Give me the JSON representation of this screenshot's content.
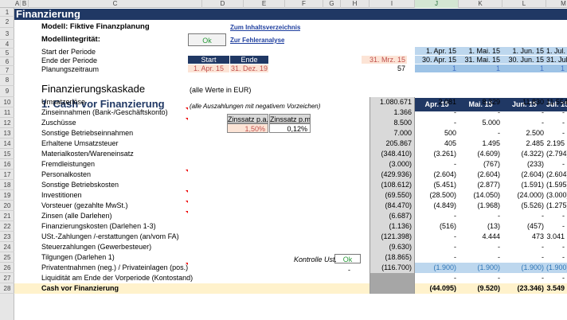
{
  "columns": [
    {
      "id": "A",
      "w": 8
    },
    {
      "id": "B",
      "w": 10
    },
    {
      "id": "C",
      "w": 218
    },
    {
      "id": "D",
      "w": 52
    },
    {
      "id": "E",
      "w": 52
    },
    {
      "id": "F",
      "w": 48
    },
    {
      "id": "G",
      "w": 22
    },
    {
      "id": "H",
      "w": 36
    },
    {
      "id": "I",
      "w": 57
    },
    {
      "id": "J",
      "w": 55
    },
    {
      "id": "K",
      "w": 55
    },
    {
      "id": "L",
      "w": 55
    },
    {
      "id": "M",
      "w": 44
    }
  ],
  "row_numbers": [
    "1",
    "2",
    "3",
    "4",
    "5",
    "6",
    "7",
    "8",
    "9",
    "10",
    "11",
    "12",
    "13",
    "14",
    "15",
    "16",
    "17",
    "18",
    "19",
    "20",
    "21",
    "22",
    "23",
    "24",
    "25",
    "26",
    "27",
    "28"
  ],
  "header": {
    "title": "Finanzierung",
    "model_label": "Modell: Fiktive Finanzplanung",
    "integrity_label": "Modellintegrität:",
    "integrity_value": "Ok",
    "link_contents": "Zum Inhaltsverzeichnis",
    "link_errors": "Zur Fehleranalyse",
    "start_label": "Start der Periode",
    "end_label": "Ende der Periode",
    "range_label": "Planungszeitraum",
    "start_hdr": "Start",
    "end_hdr": "Ende",
    "start_val": "1. Apr. 15",
    "end_val": "31. Dez. 19",
    "end_of_period": "31. Mrz. 15",
    "periods": "57"
  },
  "timeline": {
    "starts": [
      "1. Apr. 15",
      "1. Mai. 15",
      "1. Jun. 15",
      "1. Jul. 15"
    ],
    "ends": [
      "30. Apr. 15",
      "31. Mai. 15",
      "30. Jun. 15",
      "31. Jul. 15"
    ],
    "index": [
      "1",
      "1",
      "1",
      "1"
    ]
  },
  "section": {
    "title": "Finanzierungskaskade",
    "unit": "(alle Werte in EUR)",
    "sub_title": "1. Cash vor Finanzierung",
    "sub_note": "(alle Auszahlungen mit negativem Vorzeichen)",
    "months": [
      "Apr. 15",
      "Mai. 15",
      "Jun. 15",
      "Jul. 15"
    ]
  },
  "interest": {
    "hdr_pa": "Zinssatz p.a.",
    "hdr_pm": "Zinssatz p.m.",
    "val_pa": "1,50%",
    "val_pm": "0,12%"
  },
  "kontrolle": {
    "label": "Kontrolle Ust.",
    "value": "Ok",
    "dash": "-"
  },
  "rows": [
    {
      "label": "Umsatzerlöse",
      "total": "1.080.671",
      "m": [
        "2.081",
        "8.329",
        "11.830",
        "11.554"
      ]
    },
    {
      "label": "Zinseinnahmen (Bank-/Geschäftskonto)",
      "total": "1.366",
      "m": [
        "-",
        "-",
        "-",
        "-"
      ]
    },
    {
      "label": "Zuschüsse",
      "total": "8.500",
      "m": [
        "-",
        "5.000",
        "-",
        "-"
      ]
    },
    {
      "label": "Sonstige Betriebseinnahmen",
      "total": "7.000",
      "m": [
        "500",
        "-",
        "2.500",
        "-"
      ]
    },
    {
      "label": "Erhaltene Umsatzsteuer",
      "total": "205.867",
      "m": [
        "405",
        "1.495",
        "2.485",
        "2.195"
      ]
    },
    {
      "label": "Materialkosten/Wareneinsatz",
      "total": "(348.410)",
      "m": [
        "(3.261)",
        "(4.609)",
        "(4.322)",
        "(2.794)"
      ]
    },
    {
      "label": "Fremdleistungen",
      "total": "(3.000)",
      "m": [
        "-",
        "(767)",
        "(233)",
        "-"
      ]
    },
    {
      "label": "Personalkosten",
      "total": "(429.936)",
      "m": [
        "(2.604)",
        "(2.604)",
        "(2.604)",
        "(2.604)"
      ]
    },
    {
      "label": "Sonstige Betriebskosten",
      "total": "(108.612)",
      "m": [
        "(5.451)",
        "(2.877)",
        "(1.591)",
        "(1.595)"
      ]
    },
    {
      "label": "Investitionen",
      "total": "(69.550)",
      "m": [
        "(28.500)",
        "(14.050)",
        "(24.000)",
        "(3.000)"
      ]
    },
    {
      "label": "Vorsteuer (gezahlte MwSt.)",
      "total": "(84.470)",
      "m": [
        "(4.849)",
        "(1.968)",
        "(5.526)",
        "(1.275)"
      ]
    },
    {
      "label": "Zinsen (alle Darlehen)",
      "total": "(6.687)",
      "m": [
        "-",
        "-",
        "-",
        "-"
      ]
    },
    {
      "label": "Finanzierungskosten (Darlehen 1-3)",
      "total": "(1.136)",
      "m": [
        "(516)",
        "(13)",
        "(457)",
        "-"
      ]
    },
    {
      "label": "USt.-Zahlungen /-erstattungen (an/vom FA)",
      "total": "(121.398)",
      "m": [
        "-",
        "4.444",
        "473",
        "3.041"
      ]
    },
    {
      "label": "Steuerzahlungen (Gewerbesteuer)",
      "total": "(9.630)",
      "m": [
        "-",
        "-",
        "-",
        "-"
      ]
    },
    {
      "label": "Tilgungen (Darlehen 1)",
      "total": "(18.865)",
      "m": [
        "-",
        "-",
        "-",
        "-"
      ]
    },
    {
      "label": "Privatentnahmen (neg.) / Privateinlagen (pos.)",
      "total": "(116.700)",
      "m": [
        "(1.900)",
        "(1.900)",
        "(1.900)",
        "(1.900)"
      ]
    },
    {
      "label": "Liquidität am Ende der Vorperiode (Kontostand)",
      "total": "",
      "m": [
        "-",
        "-",
        "-",
        "-"
      ]
    },
    {
      "label": "Cash vor Finanzierung",
      "total": "",
      "m": [
        "(44.095)",
        "(9.520)",
        "(23.346)",
        "3.549"
      ]
    }
  ]
}
